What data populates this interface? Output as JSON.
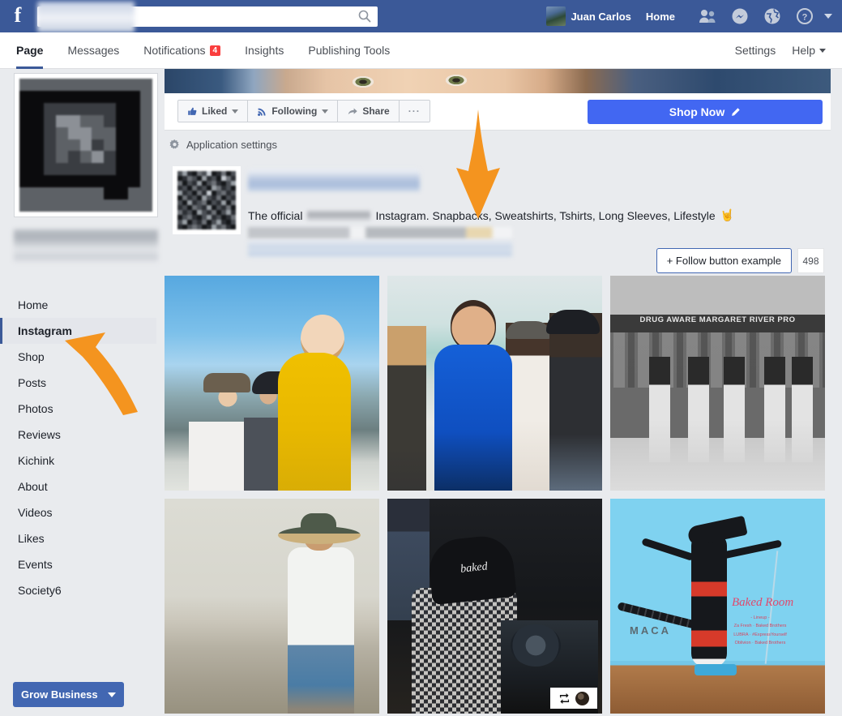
{
  "topbar": {
    "logo": "f",
    "search_placeholder": "",
    "search_icon": "search-icon",
    "user_name": "Juan Carlos",
    "home_label": "Home",
    "icons": [
      "friend-requests-icon",
      "messenger-icon",
      "notifications-globe-icon",
      "help-question-icon",
      "account-caret-icon"
    ],
    "brand_color": "#3b5998"
  },
  "page_nav": {
    "tabs": [
      {
        "label": "Page",
        "active": true,
        "badge": null
      },
      {
        "label": "Messages",
        "active": false,
        "badge": null
      },
      {
        "label": "Notifications",
        "active": false,
        "badge": "4"
      },
      {
        "label": "Insights",
        "active": false,
        "badge": null
      },
      {
        "label": "Publishing Tools",
        "active": false,
        "badge": null
      }
    ],
    "right_items": [
      {
        "label": "Settings",
        "caret": false
      },
      {
        "label": "Help",
        "caret": true
      }
    ],
    "badge_color": "#fa3e3e"
  },
  "sidebar": {
    "items": [
      {
        "label": "Home",
        "active": false
      },
      {
        "label": "Instagram",
        "active": true
      },
      {
        "label": "Shop",
        "active": false
      },
      {
        "label": "Posts",
        "active": false
      },
      {
        "label": "Photos",
        "active": false
      },
      {
        "label": "Reviews",
        "active": false
      },
      {
        "label": "Kichink",
        "active": false
      },
      {
        "label": "About",
        "active": false
      },
      {
        "label": "Videos",
        "active": false
      },
      {
        "label": "Likes",
        "active": false
      },
      {
        "label": "Events",
        "active": false
      },
      {
        "label": "Society6",
        "active": false
      }
    ],
    "grow_business_label": "Grow Business"
  },
  "action_bar": {
    "liked_label": "Liked",
    "liked_icon": "thumbs-up-icon",
    "following_label": "Following",
    "following_icon": "rss-feed-icon",
    "share_label": "Share",
    "share_icon": "share-arrow-icon",
    "more_label": "···",
    "shop_now_label": "Shop Now",
    "shop_now_icon": "pencil-edit-icon",
    "shop_now_color": "#4267f2"
  },
  "app_settings": {
    "label": "Application settings",
    "icon": "gear-icon"
  },
  "instagram_block": {
    "description_prefix": "The official",
    "description_suffix": "Instagram. Snapbacks, Sweatshirts, Tshirts, Long Sleeves, Lifestyle",
    "description_emoji": "🤘",
    "follow_button_label": "+ Follow button example",
    "follow_count": "498",
    "name_redacted": true
  },
  "photo_grid": {
    "photos": [
      {
        "name": "photo-surfers-group",
        "caption_text": "",
        "overlay_badge": false
      },
      {
        "name": "photo-western-australia-group",
        "caption_text": "",
        "overlay_badge": false
      },
      {
        "name": "photo-margaret-river-pro",
        "caption_text": "DRUG AWARE MARGARET RIVER PRO",
        "overlay_badge": false
      },
      {
        "name": "photo-man-walking-beach",
        "caption_text": "",
        "overlay_badge": false
      },
      {
        "name": "photo-dj-baked-cap",
        "caption_text": "baked",
        "overlay_badge": true
      },
      {
        "name": "photo-alien-poster",
        "caption_text": "MACA",
        "overlay_badge": false
      }
    ],
    "badge_icon": "repost-icon",
    "poster": {
      "title": "Baked Room",
      "lineup_header": "- Lineup -",
      "lines": [
        "Za Fresh · Baked Brothers",
        "LUBRA · #ExpressYourself",
        "Oblivion · Baked Brothers"
      ]
    }
  },
  "annotations": {
    "arrow_color": "#f4941f",
    "arrow_down_target": "instagram-description",
    "arrow_diagonal_target": "sidebar-item-instagram"
  }
}
